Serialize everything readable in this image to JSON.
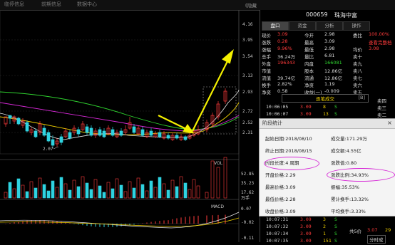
{
  "topbar": {
    "items": [
      "临停信息",
      "前期信息",
      "数据中心"
    ],
    "zoom": "《隐藏"
  },
  "chart": {
    "price_axis": [
      "4.16",
      "3.95",
      "3.54",
      "3.13",
      "2.93",
      "2.72",
      "2.52",
      "2.31"
    ],
    "low_label": "2.07",
    "vol_title": "VOL",
    "vol_axis": [
      "52.85",
      "35.23",
      "17.62",
      "万手"
    ],
    "macd_title": "MACD",
    "macd_axis": [
      "0.07",
      "-0.02",
      "-0.11"
    ],
    "colors": {
      "up": "#ff3b3b",
      "down": "#2fd3e0",
      "ma5": "#e8e8e8",
      "ma10": "#f0d000",
      "ma20": "#d628d6",
      "ma60": "#2fd32f",
      "arrow": "#f4f000"
    }
  },
  "panel": {
    "code": "000659",
    "name": "珠海中富",
    "tabs": [
      "盘口",
      "资金",
      "分析",
      "操作"
    ],
    "quotes": [
      {
        "l1": "现价",
        "v1": "3.09",
        "l2": "今开",
        "v2": "2.98",
        "l3": "委比",
        "v3": "100.00%"
      },
      {
        "l1": "涨跌",
        "v1": "0.28",
        "l2": "最高",
        "v2": "3.09",
        "l3": "",
        "v3": "查看完整档"
      },
      {
        "l1": "涨幅",
        "v1": "9.96%",
        "l2": "最低",
        "v2": "2.98",
        "l3": "均价",
        "v3": "3.08"
      },
      {
        "l1": "总手",
        "v1": "36.24万",
        "l2": "量比",
        "v2": "6.81",
        "l3": "卖十",
        "v3": ""
      },
      {
        "l1": "外盘",
        "v1": "196343",
        "l2": "内盘",
        "v2": "166081",
        "l3": "卖九",
        "v3": ""
      },
      {
        "l1": "市值",
        "v1": "",
        "l2": "股本",
        "v2": "12.86亿",
        "l3": "卖八",
        "v3": ""
      },
      {
        "l1": "流值",
        "v1": "39.74亿",
        "l2": "流通",
        "v2": "12.86亿",
        "l3": "卖七",
        "v3": ""
      },
      {
        "l1": "换手",
        "v1": "2.82%",
        "l2": "净资",
        "v2": "1.19",
        "l3": "卖六",
        "v3": ""
      },
      {
        "l1": "净资",
        "v1": "0.58",
        "l2": "收益(一)",
        "v2": "-0.009",
        "l3": "卖五",
        "v3": ""
      }
    ],
    "ticks_header": "逐笔成交",
    "ticks_tag": "[B]",
    "ticks": [
      {
        "time": "10:06:05",
        "price": "3.09",
        "vol": "8",
        "side": "S"
      },
      {
        "time": "10:06:07",
        "price": "3.09",
        "vol": "13",
        "side": "S"
      },
      {
        "time": "10:07:31",
        "price": "3.09",
        "vol": "3",
        "side": "S"
      },
      {
        "time": "10:07:32",
        "price": "3.09",
        "vol": "2",
        "side": "S"
      },
      {
        "time": "10:07:34",
        "price": "3.09",
        "vol": "1",
        "side": "S"
      },
      {
        "time": "10:07:35",
        "price": "3.09",
        "vol": "151",
        "side": "S"
      }
    ],
    "side_labels": [
      "卖四",
      "卖三",
      "卖二"
    ],
    "bottom_right": {
      "a": "分时成",
      "b": "3.07",
      "c": "29",
      "d": "共5价"
    }
  },
  "popup": {
    "title": "阶段统计",
    "close": "×",
    "rows": [
      {
        "left": "起始日期:2018/08/10",
        "right": "成交量:171.29万"
      },
      {
        "left": "终止日期:2018/08/15",
        "right": "成交额:4.55亿"
      },
      {
        "left": "时段长度:4 周期",
        "right": "涨跌值:0.80"
      },
      {
        "left": "开盘价格:2.29",
        "right": "涨跌比例:34.93%"
      },
      {
        "left": "最高价格:3.09",
        "right": "振幅:35.53%"
      },
      {
        "left": "最低价格:2.28",
        "right": "累计换手:13.32%"
      },
      {
        "left": "收盘价格:3.09",
        "right": "平均换手:3.33%"
      }
    ]
  }
}
